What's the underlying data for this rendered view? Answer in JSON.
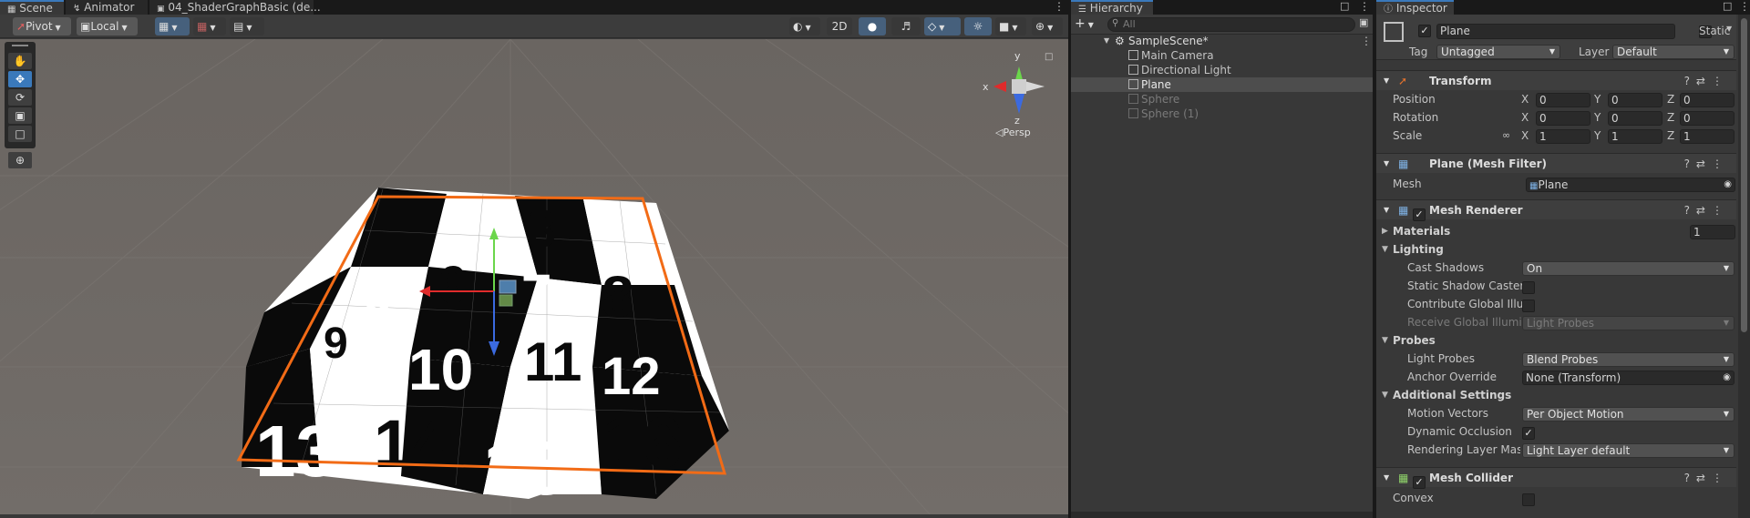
{
  "tabs": {
    "scene": "Scene",
    "animator": "Animator",
    "shader": "04_ShaderGraphBasic (de..."
  },
  "scene_toolbar": {
    "pivot": "Pivot",
    "local": "Local",
    "mode_2d": "2D"
  },
  "gizmo": {
    "x": "x",
    "y": "y",
    "z": "z",
    "persp": "◁Persp"
  },
  "plane_numbers": [
    "3",
    "5",
    "6",
    "7",
    "8",
    "9",
    "10",
    "11",
    "12",
    "13",
    "14",
    "15",
    "16"
  ],
  "hierarchy": {
    "title": "Hierarchy",
    "search_placeholder": "All",
    "scene_name": "SampleScene*",
    "items": [
      {
        "label": "Main Camera",
        "selected": false,
        "disabled": false
      },
      {
        "label": "Directional Light",
        "selected": false,
        "disabled": false
      },
      {
        "label": "Plane",
        "selected": true,
        "disabled": false
      },
      {
        "label": "Sphere",
        "selected": false,
        "disabled": true
      },
      {
        "label": "Sphere (1)",
        "selected": false,
        "disabled": true
      }
    ]
  },
  "inspector": {
    "title": "Inspector",
    "object_name": "Plane",
    "static_label": "Static",
    "tag_label": "Tag",
    "tag_value": "Untagged",
    "layer_label": "Layer",
    "layer_value": "Default",
    "transform": {
      "title": "Transform",
      "position_label": "Position",
      "rotation_label": "Rotation",
      "scale_label": "Scale",
      "position": [
        "0",
        "0",
        "0"
      ],
      "rotation": [
        "0",
        "0",
        "0"
      ],
      "scale": [
        "1",
        "1",
        "1"
      ],
      "axis_x": "X",
      "axis_y": "Y",
      "axis_z": "Z"
    },
    "mesh_filter": {
      "title": "Plane (Mesh Filter)",
      "mesh_label": "Mesh",
      "mesh_value": "Plane"
    },
    "mesh_renderer": {
      "title": "Mesh Renderer",
      "materials_label": "Materials",
      "materials_count": "1",
      "lighting_label": "Lighting",
      "cast_shadows_label": "Cast Shadows",
      "cast_shadows_value": "On",
      "static_shadow_label": "Static Shadow Caster",
      "contribute_gi_label": "Contribute Global Illum",
      "receive_gi_label": "Receive Global Illumin",
      "receive_gi_value": "Light Probes",
      "probes_label": "Probes",
      "light_probes_label": "Light Probes",
      "light_probes_value": "Blend Probes",
      "anchor_label": "Anchor Override",
      "anchor_value": "None (Transform)",
      "additional_label": "Additional Settings",
      "motion_vectors_label": "Motion Vectors",
      "motion_vectors_value": "Per Object Motion",
      "dynamic_occlusion_label": "Dynamic Occlusion",
      "rendering_layer_label": "Rendering Layer Mask",
      "rendering_layer_value": "Light Layer default"
    },
    "mesh_collider": {
      "title": "Mesh Collider",
      "convex_label": "Convex"
    }
  },
  "colors": {
    "scene_bg": "#6f6a66",
    "selection_outline": "#f26b16",
    "accent_blue": "#3a79bb",
    "panel_bg": "#383838",
    "header_bg": "#3e3e3e"
  }
}
